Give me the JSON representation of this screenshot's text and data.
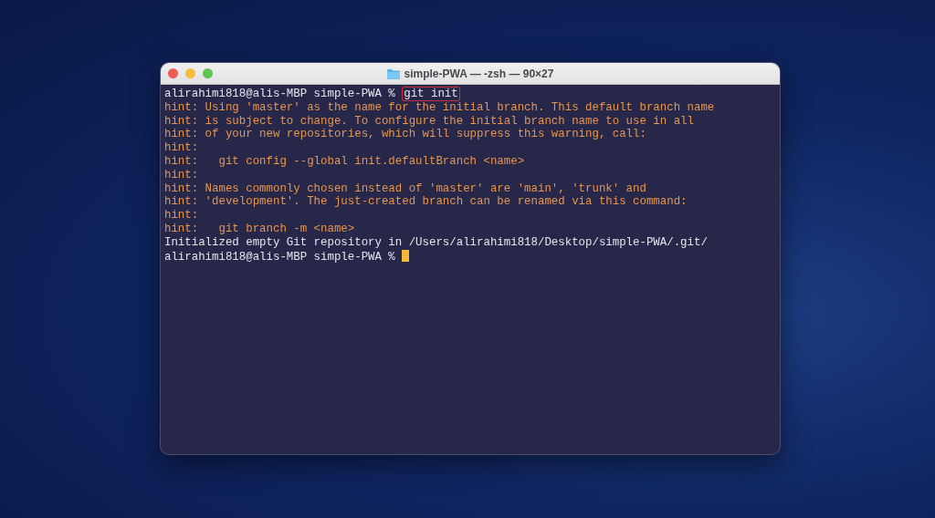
{
  "window": {
    "title": "simple-PWA — -zsh — 90×27"
  },
  "lines": [
    {
      "kind": "prompt",
      "prompt": "alirahimi818@alis-MBP simple-PWA %",
      "command": "git init",
      "highlighted": true,
      "cursor": false
    },
    {
      "kind": "hint",
      "text": "hint: Using 'master' as the name for the initial branch. This default branch name"
    },
    {
      "kind": "hint",
      "text": "hint: is subject to change. To configure the initial branch name to use in all"
    },
    {
      "kind": "hint",
      "text": "hint: of your new repositories, which will suppress this warning, call:"
    },
    {
      "kind": "hint",
      "text": "hint:"
    },
    {
      "kind": "hint",
      "text": "hint:   git config --global init.defaultBranch <name>"
    },
    {
      "kind": "hint",
      "text": "hint:"
    },
    {
      "kind": "hint",
      "text": "hint: Names commonly chosen instead of 'master' are 'main', 'trunk' and"
    },
    {
      "kind": "hint",
      "text": "hint: 'development'. The just-created branch can be renamed via this command:"
    },
    {
      "kind": "hint",
      "text": "hint:"
    },
    {
      "kind": "hint",
      "text": "hint:   git branch -m <name>"
    },
    {
      "kind": "output",
      "text": "Initialized empty Git repository in /Users/alirahimi818/Desktop/simple-PWA/.git/"
    },
    {
      "kind": "prompt",
      "prompt": "alirahimi818@alis-MBP simple-PWA %",
      "cursor": true
    }
  ]
}
